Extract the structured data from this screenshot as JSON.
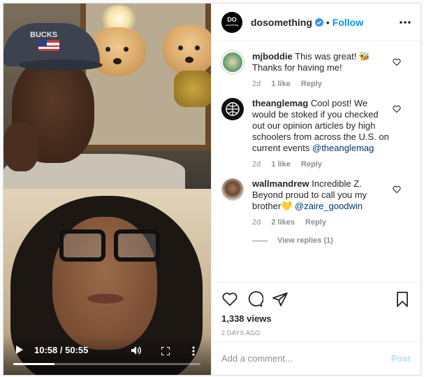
{
  "video": {
    "time_display": "10:58 / 50:55",
    "progress": 0.22,
    "cap_text": "BUCKS"
  },
  "header": {
    "avatar_text_top": "DO",
    "avatar_text_bottom": "something",
    "username": "dosomething",
    "separator": "•",
    "follow_label": "Follow"
  },
  "comments": [
    {
      "username": "mjboddie",
      "text": "This was great! 🐝 Thanks for having me!",
      "mention": "",
      "age": "2d",
      "likes": "1 like",
      "reply_label": "Reply",
      "avatar_color": "#6aa36b"
    },
    {
      "username": "theanglemag",
      "text": "Cool post! We would be stoked if you checked out our opinion articles by high schoolers from across the U.S. on current events ",
      "mention": "@theanglemag",
      "age": "2d",
      "likes": "1 like",
      "reply_label": "Reply",
      "avatar_color": "#111111"
    },
    {
      "username": "wallmandrew",
      "text": "Incredible Z. Beyond proud to call you my brother💛 ",
      "mention": "@zaire_goodwin",
      "age": "2d",
      "likes": "2 likes",
      "reply_label": "Reply",
      "avatar_color": "#b8a88f"
    }
  ],
  "view_replies": "View replies (1)",
  "stats": {
    "views": "1,338 views",
    "date": "2 DAYS AGO"
  },
  "add_comment": {
    "placeholder": "Add a comment...",
    "post_label": "Post"
  },
  "colors": {
    "link_blue": "#0095f6",
    "mention_blue": "#00376b",
    "muted_gray": "#8e8e8e",
    "post_disabled": "#b2dffc"
  },
  "icons": [
    "heart-icon",
    "comment-icon",
    "share-icon",
    "bookmark-icon",
    "more-options-icon",
    "verified-icon",
    "play-icon",
    "volume-icon",
    "fullscreen-icon",
    "video-more-icon"
  ]
}
